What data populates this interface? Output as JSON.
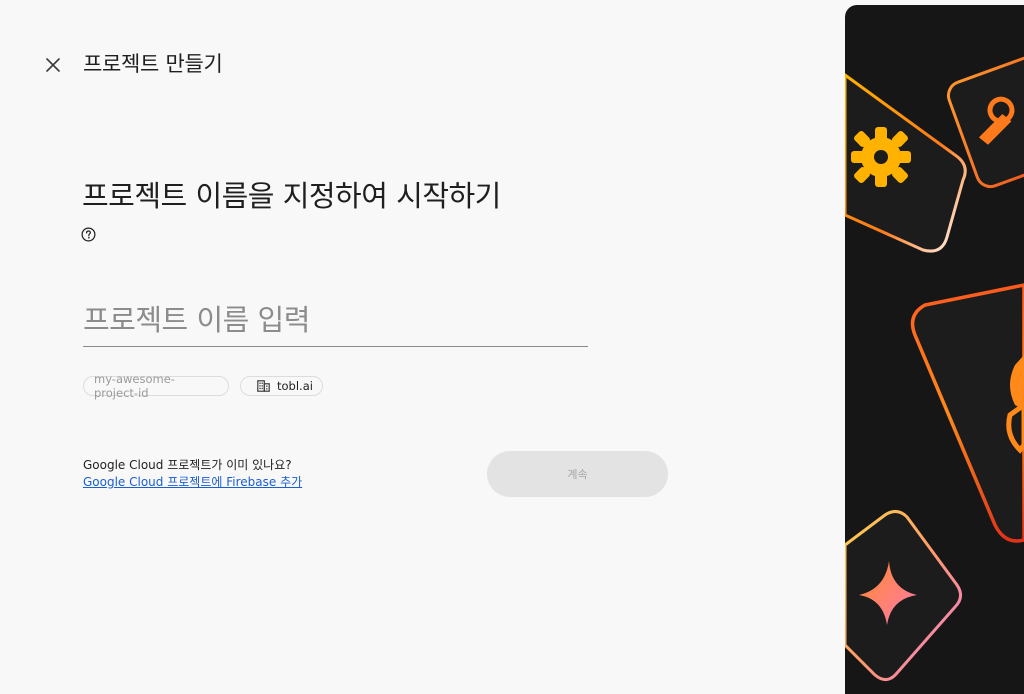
{
  "header": {
    "close_icon": "close-icon",
    "title": "프로젝트 만들기"
  },
  "main": {
    "headline": "프로젝트 이름을 지정하여 시작하기",
    "help_icon": "help-circle-icon",
    "project_name": {
      "value": "",
      "placeholder": "프로젝트 이름 입력"
    },
    "chips": {
      "project_id": "my-awesome-project-id",
      "organization_icon": "building-icon",
      "organization": "tobl.ai"
    }
  },
  "footer": {
    "question": "Google Cloud 프로젝트가 이미 있나요?",
    "link": "Google Cloud 프로젝트에 Firebase 추가",
    "continue_label": "계속"
  },
  "colors": {
    "background": "#f8f8f8",
    "link": "#1a5fd1",
    "button_disabled_bg": "#e3e3e3",
    "hero_bg": "#161616",
    "accent_orange": "#ff7a1a",
    "accent_yellow": "#ffb300"
  }
}
